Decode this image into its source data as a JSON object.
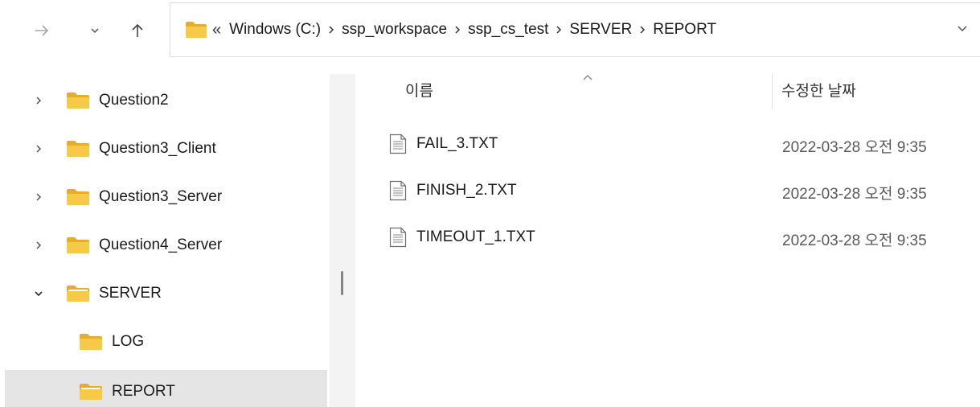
{
  "navigation": {
    "back_icon": "arrow-right-icon",
    "history_icon": "chevron-down-icon",
    "up_icon": "arrow-up-icon"
  },
  "address_bar": {
    "overflow_glyph": "«",
    "crumbs": [
      "Windows (C:)",
      "ssp_workspace",
      "ssp_cs_test",
      "SERVER",
      "REPORT"
    ]
  },
  "sidebar": {
    "items": [
      {
        "label": "Question2",
        "expander": "collapsed"
      },
      {
        "label": "Question3_Client",
        "expander": "collapsed"
      },
      {
        "label": "Question3_Server",
        "expander": "collapsed"
      },
      {
        "label": "Question4_Server",
        "expander": "collapsed"
      },
      {
        "label": "SERVER",
        "expander": "expanded"
      },
      {
        "label": "LOG",
        "expander": "none"
      },
      {
        "label": "REPORT",
        "expander": "none",
        "selected": true
      }
    ]
  },
  "file_list": {
    "columns": {
      "name": "이름",
      "date": "수정한 날짜"
    },
    "rows": [
      {
        "name": "FAIL_3.TXT",
        "date": "2022-03-28 오전 9:35"
      },
      {
        "name": "FINISH_2.TXT",
        "date": "2022-03-28 오전 9:35"
      },
      {
        "name": "TIMEOUT_1.TXT",
        "date": "2022-03-28 오전 9:35"
      }
    ]
  },
  "colors": {
    "folder_yellow": "#f7c948",
    "folder_yellow_dark": "#e6ad2a",
    "selected_bg": "#e5e5e5"
  }
}
